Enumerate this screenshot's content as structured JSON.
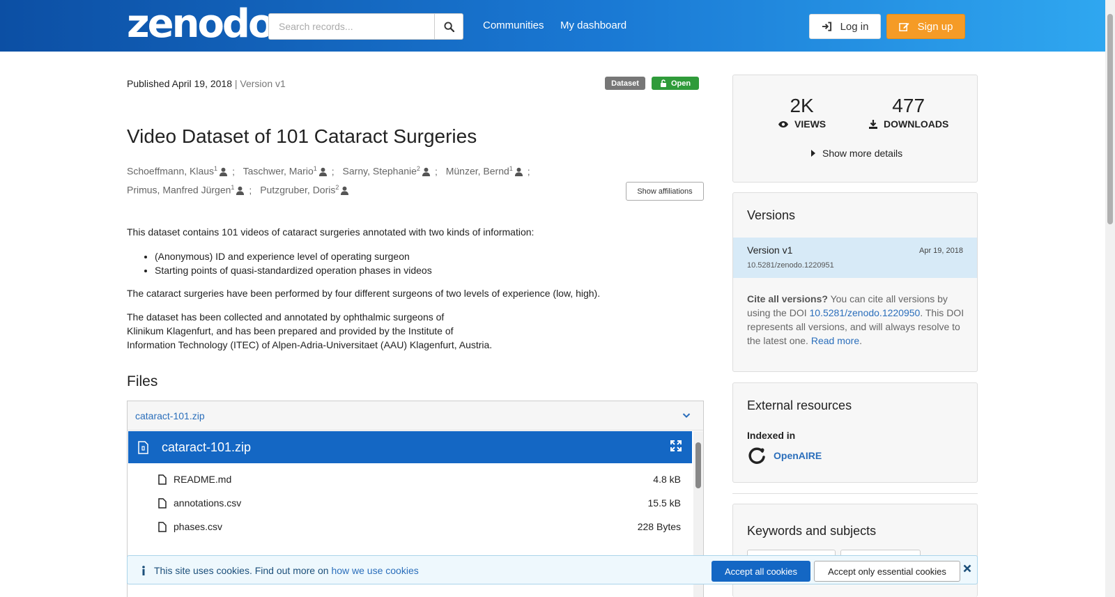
{
  "header": {
    "logo": "zenodo",
    "search_placeholder": "Search records...",
    "nav": [
      "Communities",
      "My dashboard"
    ],
    "login_label": "Log in",
    "signup_label": "Sign up"
  },
  "record": {
    "published": "Published April 19, 2018",
    "version": "| Version v1",
    "badges": [
      "Dataset",
      "Open"
    ],
    "title": "Video Dataset of 101 Cataract Surgeries",
    "authors": [
      {
        "name": "Schoeffmann, Klaus",
        "aff": "1"
      },
      {
        "name": "Taschwer, Mario",
        "aff": "1"
      },
      {
        "name": "Sarny, Stephanie",
        "aff": "2"
      },
      {
        "name": "Münzer, Bernd",
        "aff": "1"
      },
      {
        "name": "Primus, Manfred Jürgen",
        "aff": "1"
      },
      {
        "name": "Putzgruber, Doris",
        "aff": "2"
      }
    ],
    "show_affiliations": "Show affiliations",
    "description": {
      "intro": "This dataset contains 101 videos of cataract surgeries annotated with two kinds of information:",
      "bullets": [
        "(Anonymous) ID and experience level of operating surgeon",
        "Starting points of quasi-standardized operation phases in videos"
      ],
      "para2": "The cataract surgeries have been performed by four different surgeons of two levels of experience (low, high).",
      "para3_lines": [
        "The dataset has been collected and annotated by ophthalmic surgeons of",
        "Klinikum Klagenfurt, and has been prepared and provided by the Institute of",
        "Information Technology (ITEC) of Alpen-Adria-Universitaet (AAU) Klagenfurt, Austria."
      ]
    }
  },
  "files": {
    "heading": "Files",
    "archive": "cataract-101.zip",
    "preview_title": "cataract-101.zip",
    "rows": [
      {
        "name": "README.md",
        "size": "4.8 kB"
      },
      {
        "name": "annotations.csv",
        "size": "15.5 kB"
      },
      {
        "name": "phases.csv",
        "size": "228 Bytes"
      }
    ]
  },
  "stats": {
    "views": "2K",
    "views_label": "VIEWS",
    "downloads": "477",
    "downloads_label": "DOWNLOADS",
    "more": "Show more details"
  },
  "versions": {
    "title": "Versions",
    "current": {
      "name": "Version v1",
      "date": "Apr 19, 2018",
      "doi": "10.5281/zenodo.1220951"
    },
    "cite_bold": "Cite all versions?",
    "cite_text1": " You can cite all versions by using the DOI ",
    "cite_doi": "10.5281/zenodo.1220950",
    "cite_text2": ". This DOI represents all versions, and will always resolve to the latest one. ",
    "read_more": "Read more",
    "cite_end": "."
  },
  "external": {
    "title": "External resources",
    "indexed": "Indexed in",
    "source": "OpenAIRE"
  },
  "keywords": {
    "title": "Keywords and subjects"
  },
  "cookie": {
    "text": "This site uses cookies. Find out more on ",
    "link": "how we use cookies",
    "accept_all": "Accept all cookies",
    "accept_essential": "Accept only essential cookies"
  },
  "colors": {
    "header_start": "#0c4fa4",
    "header_end": "#2fa7f0",
    "signup": "#f59b26",
    "open_badge": "#2f9b3a",
    "link": "#2a6ebb"
  }
}
